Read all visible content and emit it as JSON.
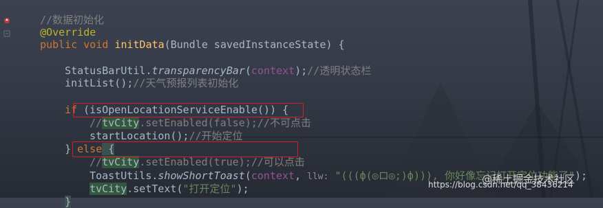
{
  "code": {
    "l1": "//数据初始化",
    "l2": "@Override",
    "l3_kw1": "public",
    "l3_kw2": "void",
    "l3_fn": "initData",
    "l3_rest": "(Bundle savedInstanceState) {",
    "l5_a": "StatusBarUtil.",
    "l5_b": "transparencyBar",
    "l5_c": "(",
    "l5_d": "context",
    "l5_e": ");",
    "l5_f": "//透明状态栏",
    "l6_a": "initList();",
    "l6_b": "//天气预报列表初始化",
    "l8_kw": "if",
    "l8_rest": " (isOpenLocationServiceEnable()) {",
    "l9_a": "//",
    "l9_b": "tvCity",
    "l9_c": ".setEnabled(false);//不可点击",
    "l10_a": "startLocation();",
    "l10_b": "//开始定位",
    "l11_a": "} ",
    "l11_kw": "else",
    "l11_b": " {",
    "l12_a": "//",
    "l12_b": "tvCity",
    "l12_c": ".setEnabled(true);//可以点击",
    "l13_a": "ToastUtils.",
    "l13_b": "showShortToast",
    "l13_c": "(",
    "l13_d": "context",
    "l13_e": ", ",
    "l13_hint": "llw:",
    "l13_str": " \"(((ф(◎ロ◎;)ф))), 你好像忘记打开定位功能了\"",
    "l13_end": ");",
    "l14_a": "tvCity",
    "l14_b": ".setText(",
    "l14_str": "\"打开定位\"",
    "l14_c": ");",
    "l15": "}"
  },
  "watermark": {
    "brand": "@稀土掘金技术社区",
    "url": "https://blog.csdn.net/qq_38436214"
  },
  "colors": {
    "comment": "#808080",
    "keyword": "#cc7832",
    "method": "#ffc66d",
    "string": "#6a8759",
    "highlight_box": "#d21f2a"
  }
}
